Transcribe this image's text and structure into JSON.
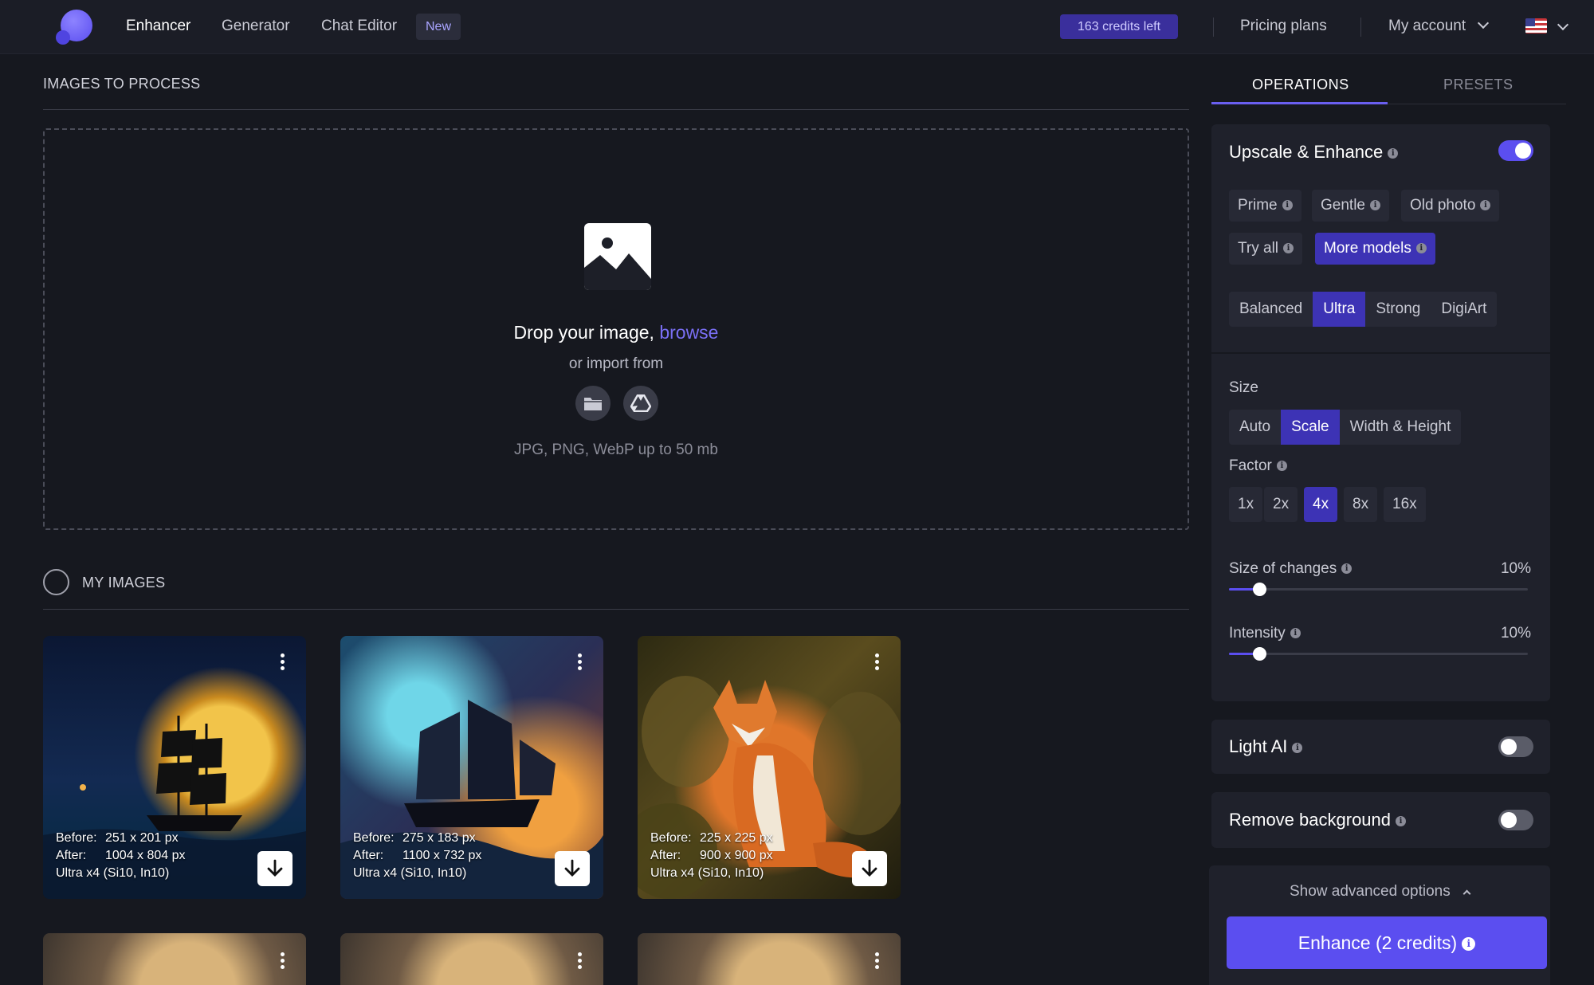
{
  "nav": {
    "links": [
      "Enhancer",
      "Generator",
      "Chat Editor"
    ],
    "new_badge": "New",
    "credits": "163 credits left",
    "pricing": "Pricing plans",
    "account": "My account"
  },
  "left": {
    "images_to_process_title": "IMAGES TO PROCESS",
    "drop_text": "Drop your image,",
    "browse": "browse",
    "import_text": "or import from",
    "formats": "JPG, PNG, WebP up to 50 mb",
    "my_images_title": "MY IMAGES"
  },
  "cards": [
    {
      "before": "251 x 201 px",
      "after": "1004 x 804 px",
      "model": "Ultra x4 (Si10, In10)"
    },
    {
      "before": "275 x 183 px",
      "after": "1100 x 732 px",
      "model": "Ultra x4 (Si10, In10)"
    },
    {
      "before": "225 x 225 px",
      "after": "900 x 900 px",
      "model": "Ultra x4 (Si10, In10)"
    }
  ],
  "card_labels": {
    "before": "Before:",
    "after": "After:"
  },
  "right": {
    "tabs": [
      "OPERATIONS",
      "PRESETS"
    ],
    "upscale_title": "Upscale & Enhance",
    "models": [
      "Prime",
      "Gentle",
      "Old photo",
      "Try all",
      "More models"
    ],
    "modes": [
      "Balanced",
      "Ultra",
      "Strong",
      "DigiArt"
    ],
    "size_label": "Size",
    "size_options": [
      "Auto",
      "Scale",
      "Width & Height"
    ],
    "factor_label": "Factor",
    "factors": [
      "1x",
      "2x",
      "4x",
      "8x",
      "16x"
    ],
    "size_of_changes_label": "Size of changes",
    "size_of_changes_value": "10%",
    "intensity_label": "Intensity",
    "intensity_value": "10%",
    "light_ai": "Light AI",
    "remove_bg": "Remove background",
    "advanced": "Show advanced options",
    "enhance_button": "Enhance (2 credits)"
  },
  "state": {
    "upscale_enabled": true,
    "light_ai_enabled": false,
    "remove_bg_enabled": false,
    "selected_model": "More models",
    "selected_mode": "Ultra",
    "selected_size": "Scale",
    "selected_factor": "4x",
    "size_of_changes_fraction": 0.1,
    "intensity_fraction": 0.1
  },
  "colors": {
    "accent": "#5b4ef0",
    "selected_chip": "#3d33b5",
    "background": "#16181f",
    "panel": "#1f212b"
  }
}
